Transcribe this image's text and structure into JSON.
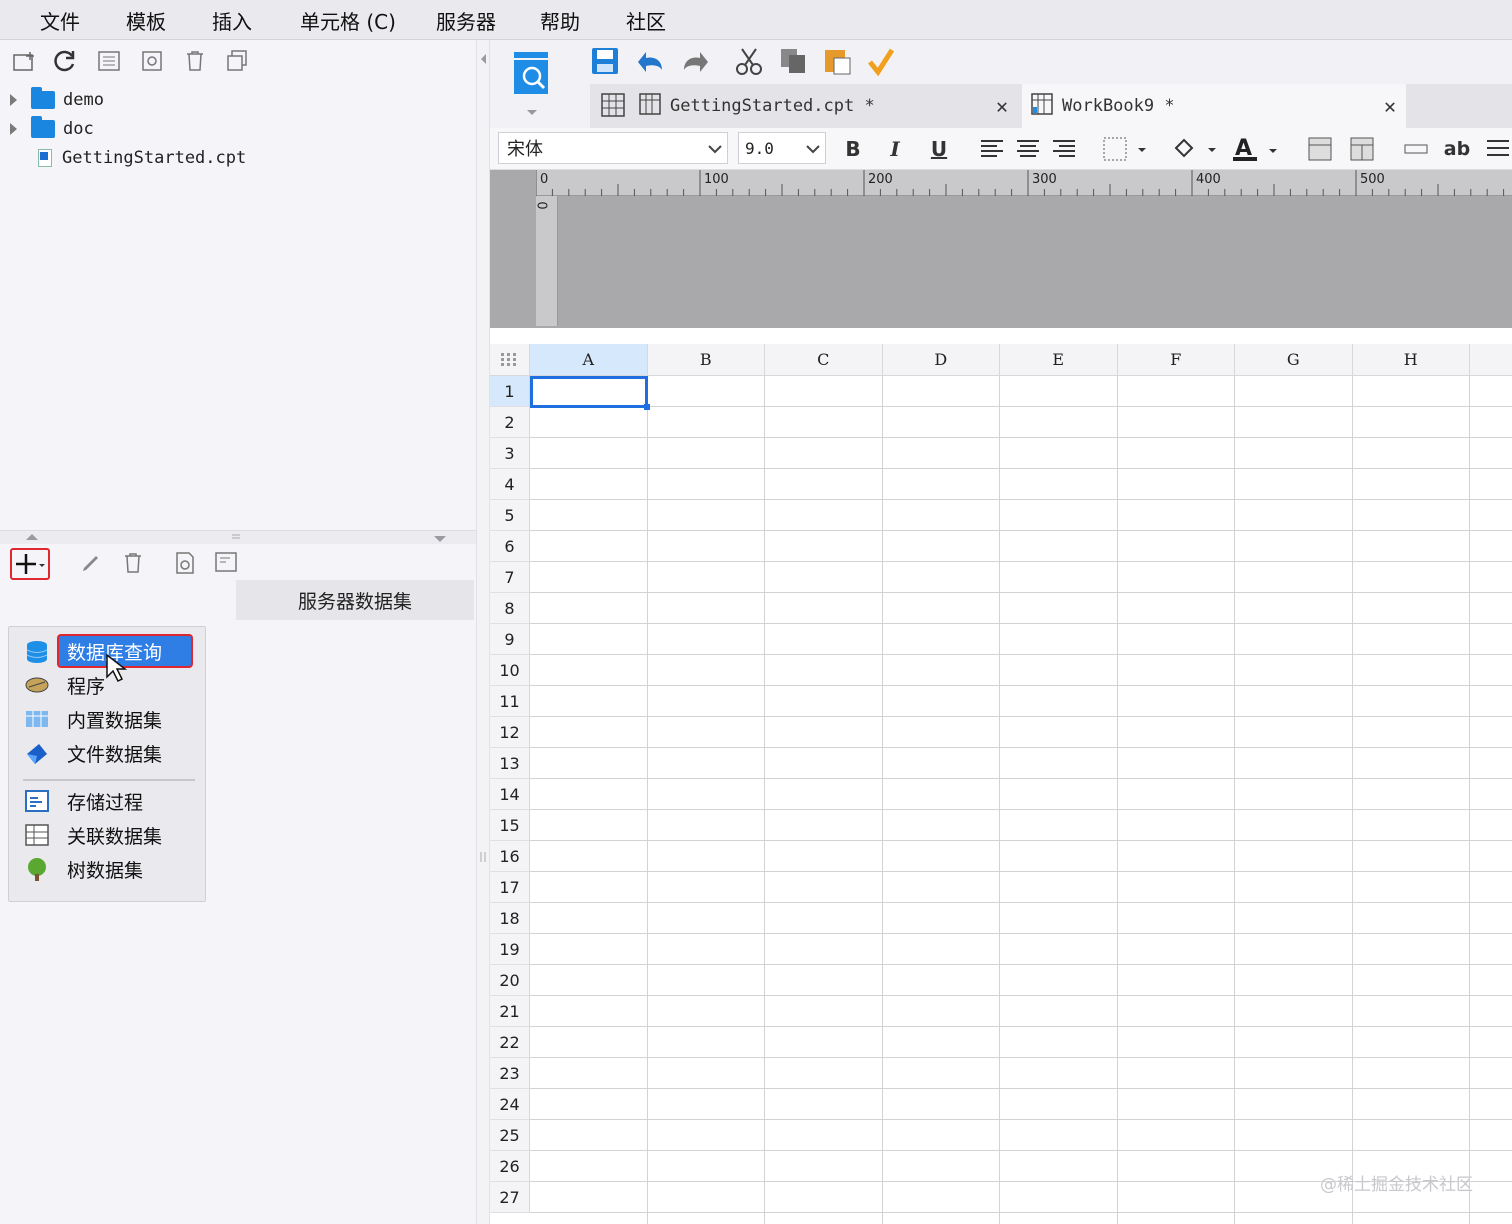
{
  "menubar": {
    "items": [
      "文件",
      "模板",
      "插入",
      "单元格 (C)",
      "服务器",
      "帮助",
      "社区"
    ]
  },
  "left_toolbar": {
    "icons": [
      "new-folder-icon",
      "refresh-icon",
      "template-icon",
      "settings-icon",
      "delete-icon",
      "copy-icon"
    ]
  },
  "file_tree": [
    {
      "label": "demo",
      "type": "folder"
    },
    {
      "label": "doc",
      "type": "folder"
    },
    {
      "label": "GettingStarted.cpt",
      "type": "file"
    }
  ],
  "dataset_panel": {
    "header": "服务器数据集",
    "menu": [
      "数据库查询",
      "程序",
      "内置数据集",
      "文件数据集",
      "存储过程",
      "关联数据集",
      "树数据集"
    ],
    "highlighted": "数据库查询"
  },
  "tabs": [
    {
      "label": "GettingStarted.cpt *"
    },
    {
      "label": "WorkBook9 *"
    }
  ],
  "format": {
    "font": "宋体",
    "size": "9.0",
    "bold": "B",
    "italic": "I",
    "underline": "U",
    "text_btn": "ab"
  },
  "ruler": {
    "h_labels": [
      "0",
      "100",
      "200",
      "300",
      "400",
      "500"
    ],
    "v_label": "0"
  },
  "sheet": {
    "columns": [
      "A",
      "B",
      "C",
      "D",
      "E",
      "F",
      "G",
      "H"
    ],
    "rows": [
      "1",
      "2",
      "3",
      "4",
      "5",
      "6",
      "7",
      "8",
      "9",
      "10",
      "11",
      "12",
      "13",
      "14",
      "15",
      "16",
      "17",
      "18",
      "19",
      "20",
      "21",
      "22",
      "23",
      "24",
      "25",
      "26",
      "27"
    ],
    "selected": "A1"
  },
  "watermark": "@稀土掘金技术社区",
  "colors": {
    "accent": "#1a86e0",
    "highlight": "#2f7ee6",
    "red_outline": "#e0262e"
  }
}
